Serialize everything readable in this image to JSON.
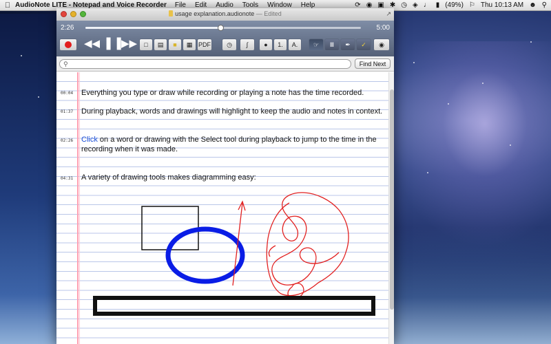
{
  "menubar": {
    "app_name": "AudioNote LITE - Notepad and Voice Recorder",
    "menus": [
      "File",
      "Edit",
      "Audio",
      "Tools",
      "Window",
      "Help"
    ],
    "battery": "(49%)",
    "clock": "Thu 10:13 AM"
  },
  "window": {
    "doc_name": "usage explanation.audionote",
    "doc_status": "— Edited"
  },
  "player": {
    "time_elapsed": "2:26",
    "time_total": "5:00",
    "progress": 0.49
  },
  "toolbar": {
    "pdf_label": "PDF",
    "size_label": "1.",
    "font_label": "A."
  },
  "search": {
    "query": "",
    "find_next_label": "Find Next"
  },
  "notes": [
    {
      "timestamp": "00:04",
      "text": "Everything you type or draw while recording or playing a note has the time recorded."
    },
    {
      "timestamp": "01:37",
      "text": "During playback, words and drawings will highlight to keep the audio and notes in context."
    },
    {
      "timestamp": "02:26",
      "link": "Click",
      "text": " on a word or drawing with the Select tool during playback to jump to the time in the recording when it was made."
    },
    {
      "timestamp": "04:31",
      "text": "A variety of drawing tools makes diagramming easy:"
    }
  ],
  "colors": {
    "record": "#e21d1d",
    "link": "#1a4fd8",
    "ellipse": "#0a1de6",
    "pen": "#e22121",
    "margin": "#ff9fb1",
    "rule": "#b9c6e8"
  },
  "icons": [
    "apple-icon",
    "record-icon",
    "rewind-icon",
    "pause-icon",
    "fast-forward-icon",
    "search-icon",
    "wifi-icon",
    "volume-icon",
    "battery-icon",
    "flag-icon",
    "user-icon",
    "spotlight-icon"
  ]
}
